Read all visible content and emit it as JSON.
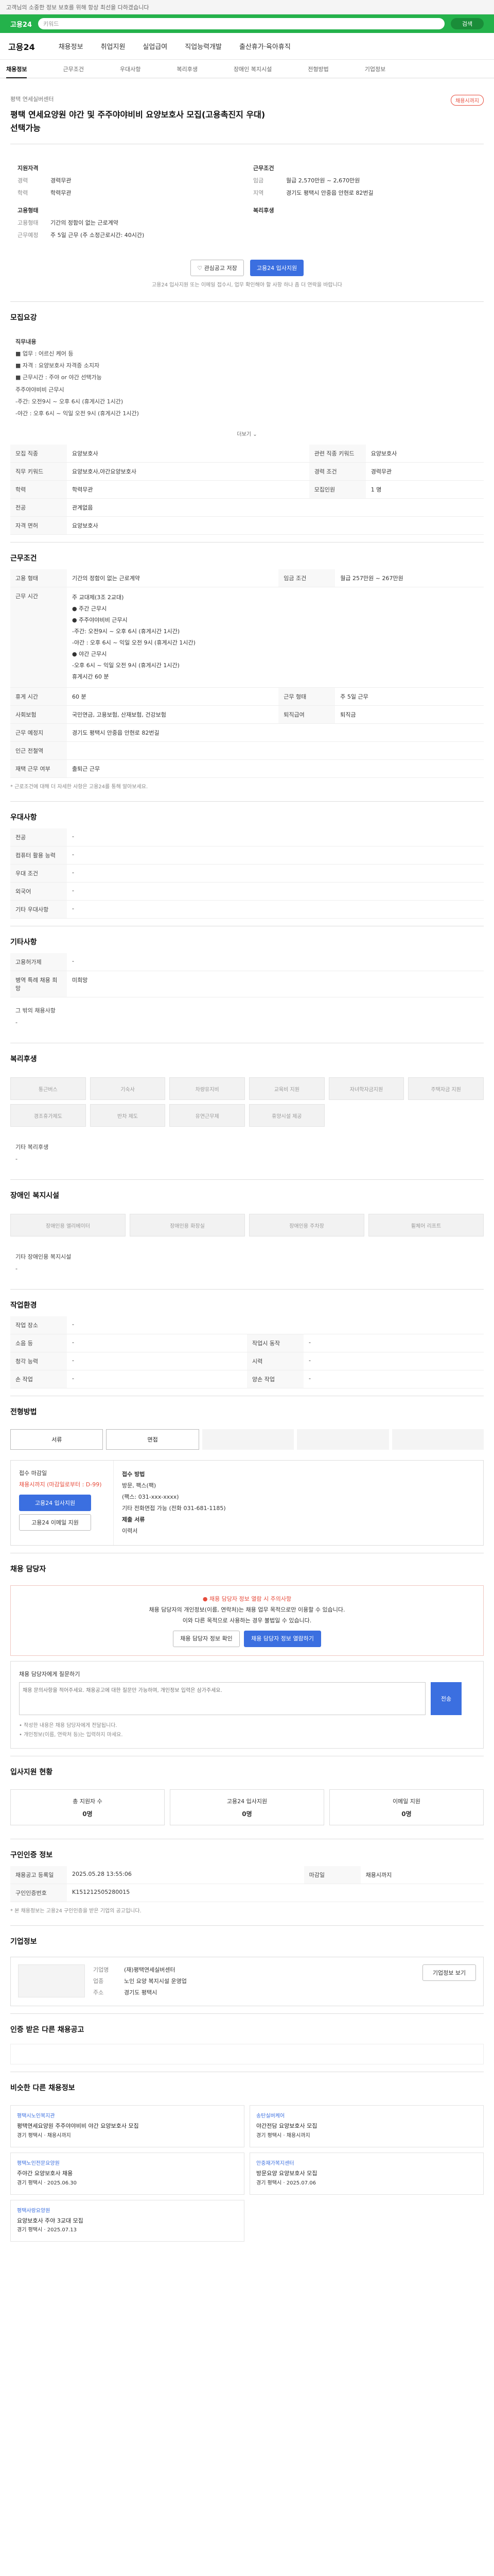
{
  "top_notice": "고객님의 소중한 정보 보호를 위해 항상 최선을 다하겠습니다",
  "topbar": {
    "logo": "고용24",
    "search_placeholder": "키워드",
    "search_btn": "검색"
  },
  "gnb": {
    "brand": "고용24",
    "items": [
      "채용정보",
      "취업지원",
      "실업급여",
      "직업능력개발",
      "출산휴가·육아휴직"
    ]
  },
  "tabs": [
    "채용정보",
    "근무조건",
    "우대사항",
    "복리후생",
    "장애인 복지시설",
    "전형방법",
    "기업정보"
  ],
  "header": {
    "company": "평택 연세실버센터",
    "title_line1": "평택 연세요양원 야간 및 주주야야비비 요양보호사 모집(고용촉진지 우대)",
    "title_line2": "선택가능",
    "status": "채용시까지"
  },
  "summary": {
    "left_title": "지원자격",
    "left_rows": [
      [
        "경력",
        "경력무관"
      ],
      [
        "학력",
        "학력무관"
      ]
    ],
    "left_title2": "고용형태",
    "left_rows2": [
      [
        "고용형태",
        "기간의 정함이 없는 근로계약"
      ],
      [
        "근무예정",
        "주 5일 근무 (주 소정근로시간: 40시간)"
      ]
    ],
    "right_title": "근무조건",
    "right_rows": [
      [
        "임금",
        "월급 2,570만원 ~ 2,670만원"
      ],
      [
        "지역",
        "경기도 평택시 안중읍 안현로 82번길 "
      ]
    ],
    "right_title2": "복리후생"
  },
  "actions": {
    "save": "관심공고 저장",
    "apply": "고용24 입사지원"
  },
  "note_small": "고용24 입사지원 또는 이메일 접수시, 업무 확인해야 할 사항 하나 좀 더 연락을 바랍니다",
  "recruit": {
    "heading": "모집요강",
    "duties_title": "직무내용",
    "duties_lines": [
      "■ 업무 : 어르신 케어 등",
      "■ 자격 : 요양보호사 자격증 소지자",
      "■ 근무시간 : 주야 or 야간 선택가능",
      "주주야야비비 근무시",
      "-주간: 오전9시 ~ 오후 6시 (휴게시간 1시간)",
      "-야간 : 오후 6시 ~ 익일 오전 9시 (휴게시간 1시간)"
    ],
    "more": "더보기",
    "table": [
      [
        "모집 직종",
        "요양보호사",
        "관련 직종 키워드",
        "요양보호사"
      ],
      [
        "직무 키워드",
        "요양보호사,야간요양보호사",
        "경력 조건",
        "경력무관"
      ],
      [
        "학력",
        "학력무관",
        "모집인원",
        "1 명"
      ],
      [
        "전공",
        "관계없음",
        "",
        ""
      ],
      [
        "자격 면허",
        "요양보호사",
        "",
        ""
      ]
    ]
  },
  "work": {
    "heading": "근무조건",
    "type": [
      "고용 형태",
      "기간의 정함이 없는 근로계약",
      "임금 조건",
      "월급 257만원 ~ 267만원"
    ],
    "hours_title": "근무 시간",
    "hours_lines": [
      "주 교대제(3조 2교대)",
      "● 주간 근무시",
      "● 주주야야비비 근무시",
      "-주간: 오전9시 ~ 오후 6시 (휴게시간 1시간)",
      "-야간 : 오후 6시 ~ 익일 오전 9시 (휴게시간 1시간)",
      "● 야간 근무시",
      "-오후 6시 ~ 익일 오전 9시 (휴게시간 1시간)",
      "휴게시간 60 분"
    ],
    "rows": [
      [
        "휴게 시간",
        "60 분",
        "근무 형태",
        "주 5일 근무"
      ],
      [
        "사회보험",
        "국민연금, 고용보험, 산재보험, 건강보험",
        "퇴직급여",
        "퇴직금"
      ],
      [
        "근무 예정지",
        "경기도 평택시 안중읍 안현로 82번길",
        "",
        ""
      ],
      [
        "인근 전철역",
        "",
        "",
        ""
      ],
      [
        "재택 근무 여부",
        "출퇴근 근무",
        "",
        ""
      ]
    ],
    "notice": "* 근로조건에 대해 더 자세한 사항은 고용24를 통해 알아보세요."
  },
  "preference": {
    "heading": "우대사항",
    "rows": [
      [
        "전공",
        "-"
      ],
      [
        "컴퓨터 활용 능력",
        "-"
      ],
      [
        "우대 조건",
        "-"
      ],
      [
        "외국어",
        "-"
      ],
      [
        "기타 우대사항",
        "-"
      ]
    ]
  },
  "other": {
    "heading": "기타사항",
    "rows": [
      [
        "고용허가제",
        "-"
      ],
      [
        "병역 특례 채용 희망",
        "미희망"
      ]
    ],
    "extra_label": "그 밖의 채용사항",
    "extra_value": "-"
  },
  "welfare": {
    "heading": "복리후생",
    "chips": [
      "통근버스",
      "기숙사",
      "차량유지비",
      "교육비 지원",
      "자녀학자금지원",
      "주택자금 지원",
      "경조휴가제도",
      "반차 제도",
      "유연근무제",
      "휴양시설 제공",
      "",
      ""
    ],
    "extra_label": "기타 복리후생",
    "extra_value": "-"
  },
  "disability": {
    "heading": "장애인 복지시설",
    "chips": [
      "장애인용 엘리베이터",
      "장애인용 화장실",
      "장애인용 주차장",
      "휠체어 리프트"
    ],
    "extra_label": "기타 장애인용 복지시설",
    "extra_value": "-"
  },
  "work_env": {
    "heading": "작업환경",
    "rows": [
      [
        "작업 장소",
        "-",
        "",
        ""
      ],
      [
        "소음 등",
        "-",
        "작업시 동작",
        "-"
      ],
      [
        "청각 능력",
        "-",
        "시력",
        "-"
      ],
      [
        "손 작업",
        "-",
        "양손 작업",
        "-"
      ]
    ]
  },
  "screening": {
    "heading": "전형방법",
    "steps": [
      "서류",
      "면접",
      "",
      "",
      ""
    ],
    "apply_title": "접수 마감일",
    "apply_deadline": "채용시까지 (마감일로부터 : D-99)",
    "apply_btn": "고용24 입사지원",
    "apply_btn2": "고용24 이메일 지원",
    "method_title": "접수 방법",
    "method_lines": [
      "방문, 팩스(팩)",
      "(팩스: 031-xxx-xxxx)",
      "기타 전화면접 가능 (전화 031-681-1185)"
    ],
    "docs_title": "제출 서류",
    "docs_value": "이력서"
  },
  "contact": {
    "heading": "채용 담당자",
    "warn_title": "채용 담당자 정보 열람 시 주의사항",
    "warn_line1": "채용 담당자의 개인정보(이름, 연락처)는 채용 업무 목적으로만 이용할 수 있습니다.",
    "warn_line2": "이와 다른 목적으로 사용하는 경우 불법일 수 있습니다.",
    "warn_btn1": "채용 담당자 정보 확인",
    "warn_btn2": "채용 담당자 정보 열람하기"
  },
  "qa": {
    "title": "채용 담당자에게 질문하기",
    "placeholder": "채용 문의사항을 적어주세요. 채용공고에 대한 질문만 가능하며, 개인정보 입력은 삼가주세요.",
    "send": "전송",
    "notes": [
      "• 작성한 내용은 채용 담당자에게 전달됩니다.",
      "• 개인정보(이름, 연락처 등)는 입력하지 마세요."
    ]
  },
  "stats": {
    "heading": "입사지원 현황",
    "items": [
      [
        "총 지원자 수",
        "0명"
      ],
      [
        "고용24 입사지원",
        "0명"
      ],
      [
        "이메일 지원",
        "0명"
      ]
    ]
  },
  "info": {
    "heading": "구인인증 정보",
    "rows": [
      [
        "채용공고 등록일",
        "2025.05.28 13:55:06",
        "마감일",
        "채용시까지"
      ],
      [
        "구인인증번호",
        "K151212505280015",
        "",
        ""
      ]
    ],
    "notice": "* 본 채용정보는 고용24 구인인증을 받은 기업의 공고입니다."
  },
  "company": {
    "heading": "기업정보",
    "btn1": "기업정보 보기",
    "rows": [
      [
        "기업명",
        "(재)평택연세실버센터"
      ],
      [
        "업종",
        "노인 요양 복지시설 운영업"
      ],
      [
        "주소",
        "경기도 평택시"
      ]
    ]
  },
  "related_heading_1": "인증 받은 다른 채용공고",
  "related_heading_2": "비슷한 다른 채용정보",
  "related": [
    {
      "org": "평택시노인복지관",
      "title": "평택연세요양원 주주야야비비 야간 요양보호사 모집",
      "meta": "경기 평택시 · 채용시까지"
    },
    {
      "org": "송탄실버케어",
      "title": "야간전담 요양보호사 모집",
      "meta": "경기 평택시 · 채용시까지"
    },
    {
      "org": "평택노인전문요양원",
      "title": "주야간 요양보호사 채용",
      "meta": "경기 평택시 · 2025.06.30"
    },
    {
      "org": "안중재가복지센터",
      "title": "방문요양 요양보호사 모집",
      "meta": "경기 평택시 · 2025.07.06"
    },
    {
      "org": "평택사랑요양원",
      "title": "요양보호사 주야 3교대 모집",
      "meta": "경기 평택시 · 2025.07.13"
    }
  ]
}
